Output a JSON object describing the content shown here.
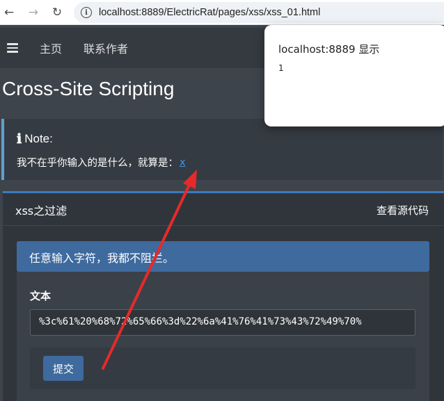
{
  "browser": {
    "url": "localhost:8889/ElectricRat/pages/xss/xss_01.html",
    "icons": {
      "back": "arrow-left-icon",
      "forward": "arrow-right-icon",
      "reload": "reload-icon",
      "site_info": "info-icon"
    }
  },
  "navbar": {
    "menu_icon": "hamburger-icon",
    "links": [
      "主页",
      "联系作者"
    ]
  },
  "page": {
    "title": "Cross-Site Scripting"
  },
  "note": {
    "heading": "Note:",
    "icon": "info-icon",
    "text": "我不在乎你输入的是什么，就算是：",
    "link_text": "x"
  },
  "card": {
    "title": "xss之过滤",
    "view_source": "查看源代码",
    "alert": "任意输入字符，我都不阻拦。",
    "field_label": "文本",
    "field_value": "%3c%61%20%68%72%65%66%3d%22%6a%41%76%41%73%43%72%49%70%",
    "submit_label": "提交"
  },
  "dialog": {
    "title": "localhost:8889 显示",
    "message": "1"
  },
  "colors": {
    "accent": "#3e6a9e",
    "note_border": "#5ea2cf",
    "annotation_arrow": "#e62a2a"
  }
}
